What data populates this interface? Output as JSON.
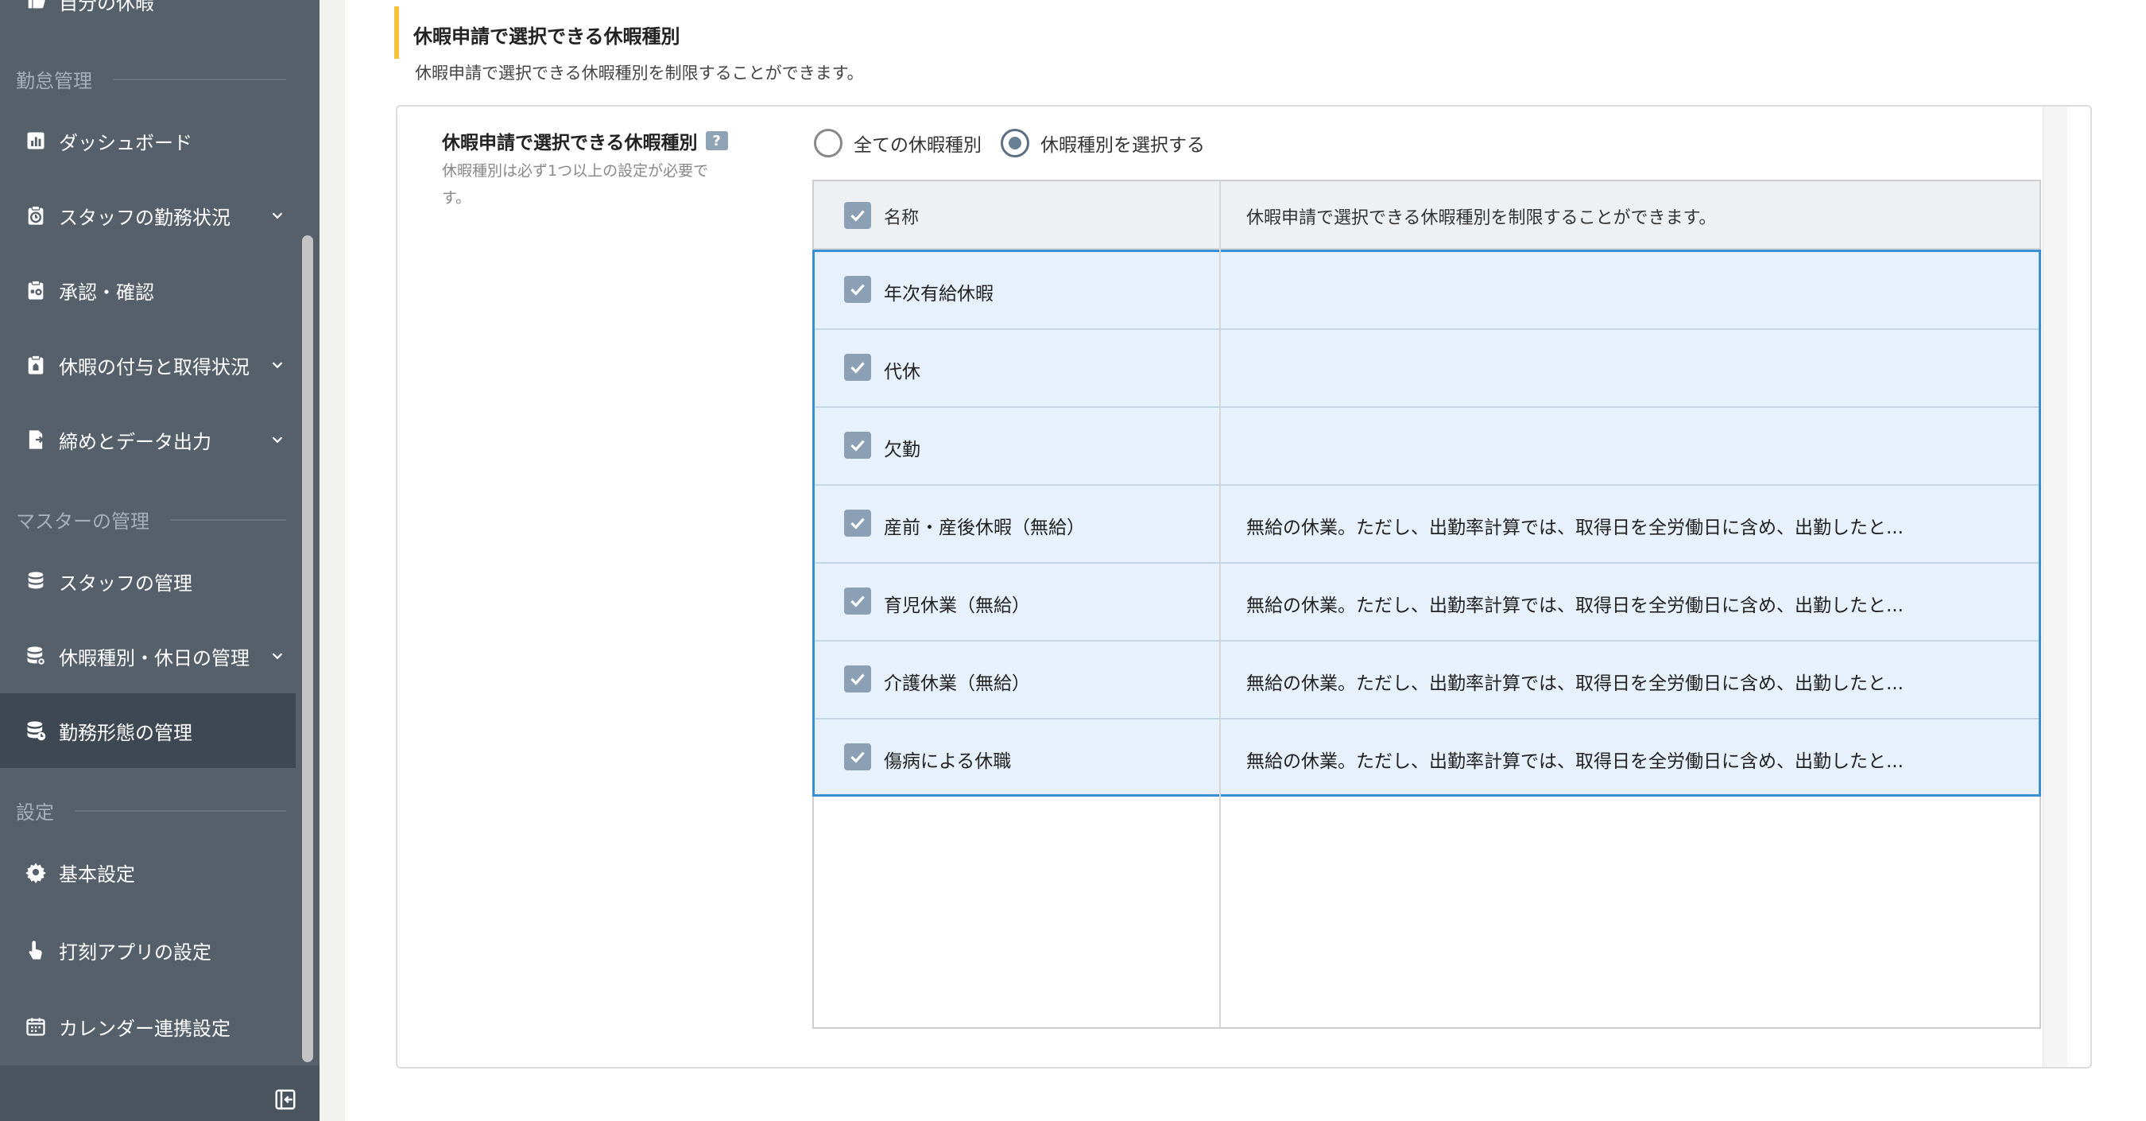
{
  "sidebar": {
    "top_partial_label": "自分の休暇",
    "sections": {
      "attendance": "勤怠管理",
      "master": "マスターの管理",
      "settings": "設定"
    },
    "items": [
      {
        "label": "ダッシュボード",
        "icon": "chart-icon"
      },
      {
        "label": "スタッフの勤務状況",
        "icon": "clock-clipboard-icon",
        "expandable": true
      },
      {
        "label": "承認・確認",
        "icon": "approve-clipboard-icon"
      },
      {
        "label": "休暇の付与と取得状況",
        "icon": "leave-clipboard-icon",
        "expandable": true
      },
      {
        "label": "締めとデータ出力",
        "icon": "document-export-icon",
        "expandable": true
      },
      {
        "label": "スタッフの管理",
        "icon": "database-icon"
      },
      {
        "label": "休暇種別・休日の管理",
        "icon": "database-gear-icon",
        "expandable": true
      },
      {
        "label": "勤務形態の管理",
        "icon": "database-clock-icon",
        "active": true
      },
      {
        "label": "基本設定",
        "icon": "gear-icon"
      },
      {
        "label": "打刻アプリの設定",
        "icon": "hand-tap-icon"
      },
      {
        "label": "カレンダー連携設定",
        "icon": "calendar-icon"
      }
    ]
  },
  "main": {
    "title": "休暇申請で選択できる休暇種別",
    "description": "休暇申請で選択できる休暇種別を制限することができます。",
    "field": {
      "label": "休暇申請で選択できる休暇種別",
      "help": "?",
      "note": "休暇種別は必ず1つ以上の設定が必要です。"
    },
    "radios": [
      {
        "label": "全ての休暇種別",
        "checked": false
      },
      {
        "label": "休暇種別を選択する",
        "checked": true
      }
    ],
    "table": {
      "headers": {
        "name": "名称",
        "description": "休暇申請で選択できる休暇種別を制限することができます。"
      },
      "rows": [
        {
          "name": "年次有給休暇",
          "description": "",
          "checked": true
        },
        {
          "name": "代休",
          "description": "",
          "checked": true
        },
        {
          "name": "欠勤",
          "description": "",
          "checked": true
        },
        {
          "name": "産前・産後休暇（無給）",
          "description": "無給の休業。ただし、出勤率計算では、取得日を全労働日に含め、出勤したと...",
          "checked": true
        },
        {
          "name": "育児休業（無給）",
          "description": "無給の休業。ただし、出勤率計算では、取得日を全労働日に含め、出勤したと...",
          "checked": true
        },
        {
          "name": "介護休業（無給）",
          "description": "無給の休業。ただし、出勤率計算では、取得日を全労働日に含め、出勤したと...",
          "checked": true
        },
        {
          "name": "傷病による休職",
          "description": "無給の休業。ただし、出勤率計算では、取得日を全労働日に含め、出勤したと...",
          "checked": true
        }
      ]
    }
  },
  "colors": {
    "sidebar_bg": "#55606b",
    "sidebar_active": "#3e4852",
    "accent_bar": "#f5c23a",
    "selected_border": "#3a8fd4",
    "selected_bg": "#e7f1fb",
    "checkbox": "#8ba0b4"
  }
}
